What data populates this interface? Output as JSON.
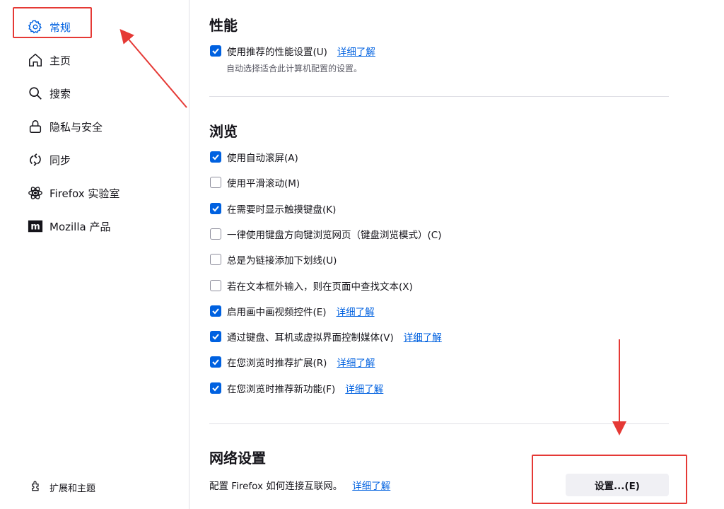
{
  "sidebar": {
    "items": [
      {
        "label": "常规",
        "icon": "gear-icon",
        "active": true
      },
      {
        "label": "主页",
        "icon": "home-icon"
      },
      {
        "label": "搜索",
        "icon": "search-icon"
      },
      {
        "label": "隐私与安全",
        "icon": "lock-icon"
      },
      {
        "label": "同步",
        "icon": "sync-icon"
      },
      {
        "label": "Firefox 实验室",
        "icon": "flask-atom-icon"
      },
      {
        "label": "Mozilla 产品",
        "icon": "mozilla-logo-icon"
      }
    ],
    "footer": [
      {
        "label": "扩展和主题",
        "icon": "puzzle-icon"
      }
    ]
  },
  "performance": {
    "title": "性能",
    "option_label": "使用推荐的性能设置(U)",
    "option_checked": true,
    "link": "详细了解",
    "description": "自动选择适合此计算机配置的设置。"
  },
  "browsing": {
    "title": "浏览",
    "options": [
      {
        "label": "使用自动滚屏(A)",
        "checked": true,
        "link": ""
      },
      {
        "label": "使用平滑滚动(M)",
        "checked": false,
        "link": ""
      },
      {
        "label": "在需要时显示触摸键盘(K)",
        "checked": true,
        "link": ""
      },
      {
        "label": "一律使用键盘方向键浏览网页（键盘浏览模式）(C)",
        "checked": false,
        "link": ""
      },
      {
        "label": "总是为链接添加下划线(U)",
        "checked": false,
        "link": ""
      },
      {
        "label": "若在文本框外输入，则在页面中查找文本(X)",
        "checked": false,
        "link": ""
      },
      {
        "label": "启用画中画视频控件(E)",
        "checked": true,
        "link": "详细了解"
      },
      {
        "label": "通过键盘、耳机或虚拟界面控制媒体(V)",
        "checked": true,
        "link": "详细了解"
      },
      {
        "label": "在您浏览时推荐扩展(R)",
        "checked": true,
        "link": "详细了解"
      },
      {
        "label": "在您浏览时推荐新功能(F)",
        "checked": true,
        "link": "详细了解"
      }
    ]
  },
  "network": {
    "title": "网络设置",
    "description": "配置 Firefox 如何连接互联网。",
    "link": "详细了解",
    "button_label": "设置...(E)"
  },
  "colors": {
    "accent": "#0061e0",
    "annotation": "#e53935"
  }
}
